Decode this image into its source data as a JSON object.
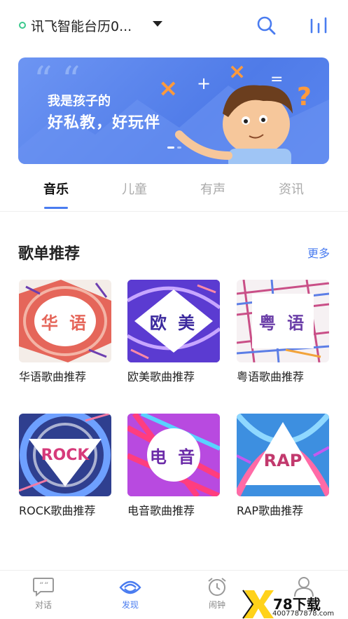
{
  "header": {
    "device_name": "讯飞智能台历0...",
    "status_color": "#3cc98e"
  },
  "banner": {
    "line1": "我是孩子的",
    "line2": "好私教，好玩伴",
    "slides_total": 2,
    "active_slide": 1
  },
  "tabs": [
    {
      "label": "音乐",
      "active": true
    },
    {
      "label": "儿童",
      "active": false
    },
    {
      "label": "有声",
      "active": false
    },
    {
      "label": "资讯",
      "active": false
    }
  ],
  "playlist_section": {
    "title": "歌单推荐",
    "more": "更多",
    "items": [
      {
        "cover_text": "华 语",
        "title": "华语歌曲推荐"
      },
      {
        "cover_text": "欧 美",
        "title": "欧美歌曲推荐"
      },
      {
        "cover_text": "粤 语",
        "title": "粤语歌曲推荐"
      },
      {
        "cover_text": "ROCK",
        "title": "ROCK歌曲推荐"
      },
      {
        "cover_text": "电 音",
        "title": "电音歌曲推荐"
      },
      {
        "cover_text": "RAP",
        "title": "RAP歌曲推荐"
      }
    ]
  },
  "bottom_nav": [
    {
      "label": "对话",
      "icon": "chat-icon",
      "active": false
    },
    {
      "label": "发现",
      "icon": "discover-icon",
      "active": true
    },
    {
      "label": "闹钟",
      "icon": "alarm-icon",
      "active": false
    },
    {
      "label": "",
      "icon": "profile-icon",
      "active": false
    }
  ],
  "watermark": {
    "text": "78下载",
    "url": "4007787878.com"
  },
  "colors": {
    "accent": "#4a7cf0",
    "banner": "#5a86ef"
  }
}
